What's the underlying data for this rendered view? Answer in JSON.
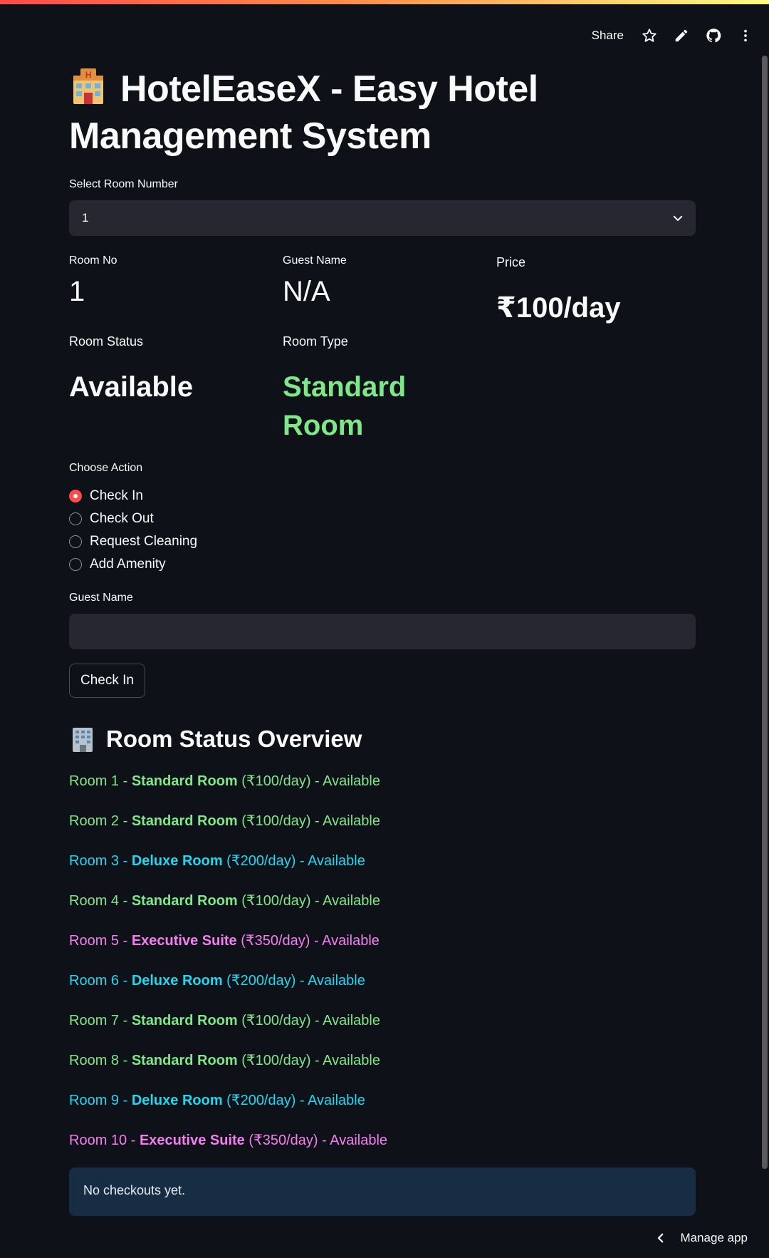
{
  "toolbar": {
    "share_label": "Share"
  },
  "title": "HotelEaseX - Easy Hotel Management System",
  "room_select": {
    "label": "Select Room Number",
    "value": "1"
  },
  "details": {
    "room_no_label": "Room No",
    "room_no": "1",
    "guest_name_label": "Guest Name",
    "guest_name": "N/A",
    "price_label": "Price",
    "price": "₹100/day",
    "status_label": "Room Status",
    "status": "Available",
    "type_label": "Room Type",
    "type": "Standard Room"
  },
  "action": {
    "label": "Choose Action",
    "options": [
      "Check In",
      "Check Out",
      "Request Cleaning",
      "Add Amenity"
    ],
    "selected": "Check In"
  },
  "guest_input": {
    "label": "Guest Name",
    "value": "",
    "placeholder": ""
  },
  "submit_label": "Check In",
  "overview": {
    "title": "Room Status Overview",
    "rooms": [
      {
        "prefix": "Room 1 - ",
        "type": "Standard Room",
        "suffix": " (₹100/day) - Available",
        "color": "#7ee787"
      },
      {
        "prefix": "Room 2 - ",
        "type": "Standard Room",
        "suffix": " (₹100/day) - Available",
        "color": "#7ee787"
      },
      {
        "prefix": "Room 3 - ",
        "type": "Deluxe Room",
        "suffix": " (₹200/day) - Available",
        "color": "#1fd8f0"
      },
      {
        "prefix": "Room 4 - ",
        "type": "Standard Room",
        "suffix": " (₹100/day) - Available",
        "color": "#7ee787"
      },
      {
        "prefix": "Room 5 - ",
        "type": "Executive Suite",
        "suffix": " (₹350/day) - Available",
        "color": "#f47ef0"
      },
      {
        "prefix": "Room 6 - ",
        "type": "Deluxe Room",
        "suffix": " (₹200/day) - Available",
        "color": "#1fd8f0"
      },
      {
        "prefix": "Room 7 - ",
        "type": "Standard Room",
        "suffix": " (₹100/day) - Available",
        "color": "#7ee787"
      },
      {
        "prefix": "Room 8 - ",
        "type": "Standard Room",
        "suffix": " (₹100/day) - Available",
        "color": "#7ee787"
      },
      {
        "prefix": "Room 9 - ",
        "type": "Deluxe Room",
        "suffix": " (₹200/day) - Available",
        "color": "#1fd8f0"
      },
      {
        "prefix": "Room 10 - ",
        "type": "Executive Suite",
        "suffix": " (₹350/day) - Available",
        "color": "#f47ef0"
      }
    ]
  },
  "info_message": "No checkouts yet.",
  "manage_label": "Manage app",
  "colors": {
    "accent": "#ff4b4b",
    "room_type_value": "#7ee787",
    "background": "#0e1117",
    "widget_bg": "#262730",
    "info_bg": "#172d43"
  }
}
